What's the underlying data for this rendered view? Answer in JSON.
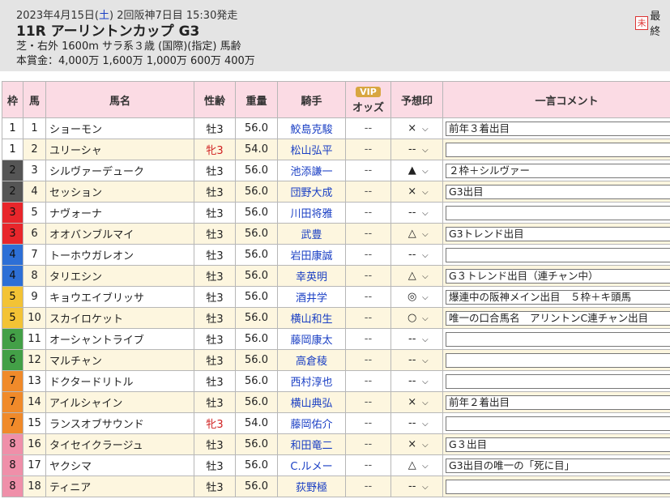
{
  "race": {
    "date_prefix": "2023年4月15日(",
    "dow": "土",
    "date_suffix": ") 2回阪神7日目 15:30発走",
    "title": "11R アーリントンカップ G3",
    "conditions": "芝・右外 1600m サラ系３歳 (国際)(指定) 馬齢",
    "prize": "本賞金：4,000万 1,600万 1,000万 600万 400万",
    "unread_badge": "未",
    "last_label": "最終"
  },
  "columns": {
    "waku": "枠",
    "num": "馬",
    "name": "馬名",
    "sex": "性齢",
    "weight": "重量",
    "jockey": "騎手",
    "vip": "VIP",
    "odds": "オッズ",
    "mark": "予想印",
    "comment": "一言コメント"
  },
  "colors": {
    "header_bg": "#e4e4e4",
    "th_bg": "#fbdbe4",
    "jockey_link": "#1a3fc4",
    "female": "#d02020"
  },
  "rows": [
    {
      "waku": "1",
      "num": "1",
      "name": "ショーモン",
      "sex": "牡3",
      "weight": "56.0",
      "jockey": "鮫島克駿",
      "odds": "--",
      "mark": "×",
      "comment": "前年３着出目"
    },
    {
      "waku": "1",
      "num": "2",
      "name": "ユリーシャ",
      "sex": "牝3",
      "weight": "54.0",
      "jockey": "松山弘平",
      "odds": "--",
      "mark": "--",
      "comment": ""
    },
    {
      "waku": "2",
      "num": "3",
      "name": "シルヴァーデューク",
      "sex": "牡3",
      "weight": "56.0",
      "jockey": "池添謙一",
      "odds": "--",
      "mark": "▲",
      "comment": "２枠＋シルヴァー"
    },
    {
      "waku": "2",
      "num": "4",
      "name": "セッション",
      "sex": "牡3",
      "weight": "56.0",
      "jockey": "団野大成",
      "odds": "--",
      "mark": "×",
      "comment": "G3出目"
    },
    {
      "waku": "3",
      "num": "5",
      "name": "ナヴォーナ",
      "sex": "牡3",
      "weight": "56.0",
      "jockey": "川田将雅",
      "odds": "--",
      "mark": "--",
      "comment": ""
    },
    {
      "waku": "3",
      "num": "6",
      "name": "オオバンブルマイ",
      "sex": "牡3",
      "weight": "56.0",
      "jockey": "武豊",
      "odds": "--",
      "mark": "△",
      "comment": "G3トレンド出目"
    },
    {
      "waku": "4",
      "num": "7",
      "name": "トーホウガレオン",
      "sex": "牡3",
      "weight": "56.0",
      "jockey": "岩田康誠",
      "odds": "--",
      "mark": "--",
      "comment": ""
    },
    {
      "waku": "4",
      "num": "8",
      "name": "タリエシン",
      "sex": "牡3",
      "weight": "56.0",
      "jockey": "幸英明",
      "odds": "--",
      "mark": "△",
      "comment": "G３トレンド出目（連チャン中）"
    },
    {
      "waku": "5",
      "num": "9",
      "name": "キョウエイブリッサ",
      "sex": "牡3",
      "weight": "56.0",
      "jockey": "酒井学",
      "odds": "--",
      "mark": "◎",
      "comment": "爆連中の阪神メイン出目　５枠＋キ頭馬"
    },
    {
      "waku": "5",
      "num": "10",
      "name": "スカイロケット",
      "sex": "牡3",
      "weight": "56.0",
      "jockey": "横山和生",
      "odds": "--",
      "mark": "○",
      "comment": "唯一の口合馬名　アリントンC連チャン出目"
    },
    {
      "waku": "6",
      "num": "11",
      "name": "オーシャントライブ",
      "sex": "牡3",
      "weight": "56.0",
      "jockey": "藤岡康太",
      "odds": "--",
      "mark": "--",
      "comment": ""
    },
    {
      "waku": "6",
      "num": "12",
      "name": "マルチャン",
      "sex": "牡3",
      "weight": "56.0",
      "jockey": "高倉稜",
      "odds": "--",
      "mark": "--",
      "comment": ""
    },
    {
      "waku": "7",
      "num": "13",
      "name": "ドクタードリトル",
      "sex": "牡3",
      "weight": "56.0",
      "jockey": "西村淳也",
      "odds": "--",
      "mark": "--",
      "comment": ""
    },
    {
      "waku": "7",
      "num": "14",
      "name": "アイルシャイン",
      "sex": "牡3",
      "weight": "56.0",
      "jockey": "横山典弘",
      "odds": "--",
      "mark": "×",
      "comment": "前年２着出目"
    },
    {
      "waku": "7",
      "num": "15",
      "name": "ランスオブサウンド",
      "sex": "牝3",
      "weight": "54.0",
      "jockey": "藤岡佑介",
      "odds": "--",
      "mark": "--",
      "comment": ""
    },
    {
      "waku": "8",
      "num": "16",
      "name": "タイセイクラージュ",
      "sex": "牡3",
      "weight": "56.0",
      "jockey": "和田竜二",
      "odds": "--",
      "mark": "×",
      "comment": "G３出目"
    },
    {
      "waku": "8",
      "num": "17",
      "name": "ヤクシマ",
      "sex": "牡3",
      "weight": "56.0",
      "jockey": "C.ルメー",
      "odds": "--",
      "mark": "△",
      "comment": "G3出目の唯一の「死に目」"
    },
    {
      "waku": "8",
      "num": "18",
      "name": "ティニア",
      "sex": "牡3",
      "weight": "56.0",
      "jockey": "荻野極",
      "odds": "--",
      "mark": "--",
      "comment": ""
    }
  ]
}
